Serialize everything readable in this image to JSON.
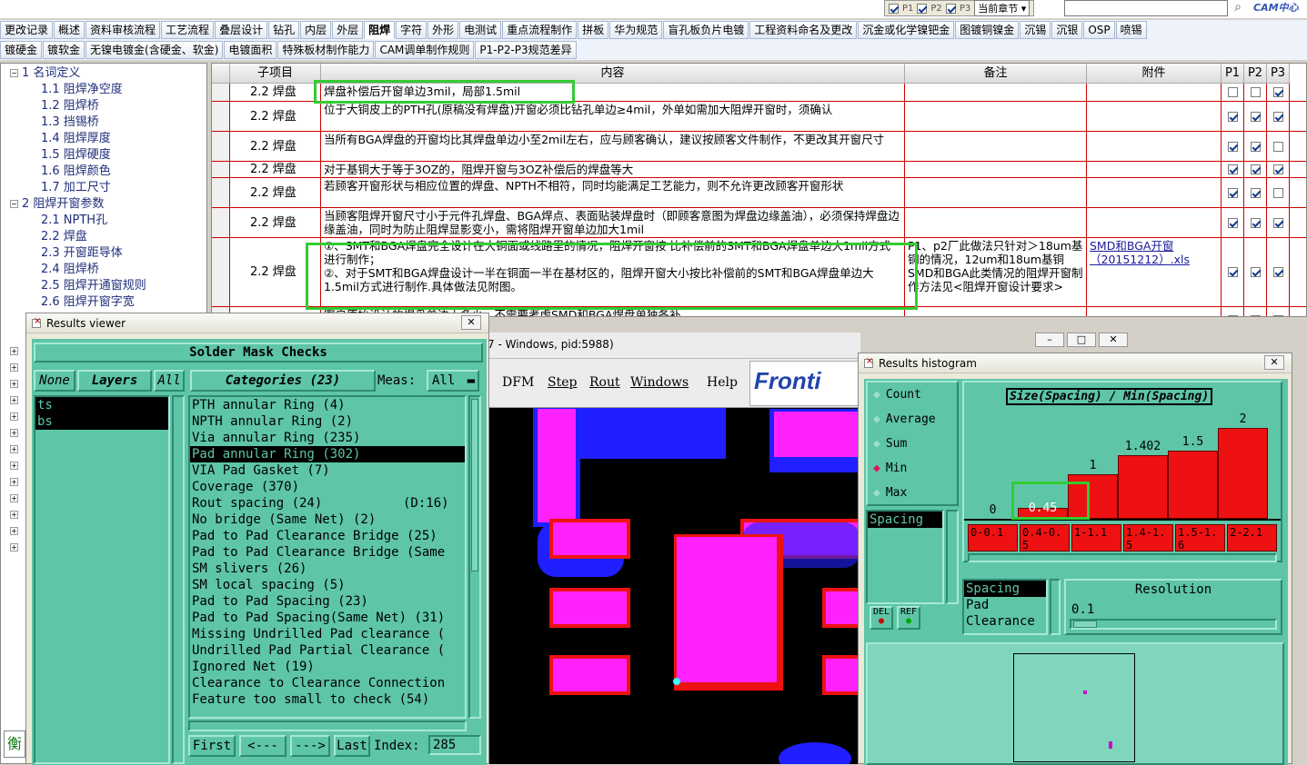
{
  "top_controls": {
    "p1": "P1",
    "p2": "P2",
    "p3": "P3",
    "chapter_select": "当前章节 ▾",
    "logo": "CAM中心"
  },
  "tabs_row1": [
    "更改记录",
    "概述",
    "资料审核流程",
    "工艺流程",
    "叠层设计",
    "钻孔",
    "内层",
    "外层",
    "阻焊",
    "字符",
    "外形",
    "电测试",
    "重点流程制作",
    "拼板",
    "华为规范",
    "盲孔板负片电镀",
    "工程资料命名及更改",
    "沉金或化学镍钯金",
    "图镀铜镍金",
    "沉锡",
    "沉银",
    "OSP",
    "喷锡"
  ],
  "tabs_row2": [
    "镀硬金",
    "镀软金",
    "无镍电镀金(含硬金、软金)",
    "电镀面积",
    "特殊板材制作能力",
    "CAM调单制作规则",
    "P1-P2-P3规范差异"
  ],
  "active_tab": "阻焊",
  "tree": {
    "sec1": "1 名词定义",
    "sec1_items": [
      "1.1 阻焊净空度",
      "1.2 阻焊桥",
      "1.3 挡锡桥",
      "1.4 阻焊厚度",
      "1.5 阻焊硬度",
      "1.6 阻焊颜色",
      "1.7 加工尺寸"
    ],
    "sec2": "2 阻焊开窗参数",
    "sec2_items": [
      "2.1 NPTH孔",
      "2.2 焊盘",
      "2.3 开窗距导体",
      "2.4 阻焊桥",
      "2.5 阻焊开通窗规则",
      "2.6 阻焊开窗字宽"
    ]
  },
  "table": {
    "headers": [
      "子项目",
      "内容",
      "备注",
      "附件",
      "P1",
      "P2",
      "P3"
    ],
    "rows": [
      {
        "cat": "2.2 焊盘",
        "content": "焊盘补偿后开窗单边3mil，局部1.5mil",
        "note": "",
        "attach": "",
        "p": [
          false,
          false,
          true
        ]
      },
      {
        "cat": "2.2 焊盘",
        "content": "位于大铜皮上的PTH孔(原稿没有焊盘)开窗必须比钻孔单边≥4mil，外单如需加大阻焊开窗时，须确认",
        "note": "",
        "attach": "",
        "p": [
          true,
          true,
          true
        ]
      },
      {
        "cat": "2.2 焊盘",
        "content": "当所有BGA焊盘的开窗均比其焊盘单边小至2mil左右，应与顾客确认，建议按顾客文件制作，不更改其开窗尺寸",
        "note": "",
        "attach": "",
        "p": [
          true,
          true,
          false
        ]
      },
      {
        "cat": "2.2 焊盘",
        "content": "对于基铜大于等于3OZ的，阻焊开窗与3OZ补偿后的焊盘等大",
        "note": "",
        "attach": "",
        "p": [
          true,
          true,
          true
        ]
      },
      {
        "cat": "2.2 焊盘",
        "content": "若顾客开窗形状与相应位置的焊盘、NPTH不相符，同时均能满足工艺能力，则不允许更改顾客开窗形状",
        "note": "",
        "attach": "",
        "p": [
          true,
          true,
          false
        ]
      },
      {
        "cat": "2.2 焊盘",
        "content": "当顾客阻焊开窗尺寸小于元件孔焊盘、BGA焊点、表面贴装焊盘时（即顾客意图为焊盘边缘盖油），必须保持焊盘边缘盖油，同时为防止阻焊显影变小，需将阻焊开窗单边加大1mil",
        "note": "",
        "attach": "",
        "p": [
          true,
          true,
          true
        ]
      },
      {
        "cat": "2.2 焊盘",
        "content": "①、SMT和BGA焊盘完全设计在大铜面或线路里的情况，阻焊开窗按 比补偿前的SMT和BGA焊盘单边大1mil方式进行制作；\n②、对于SMT和BGA焊盘设计一半在铜面一半在基材区的，阻焊开窗大小按比补偿前的SMT和BGA焊盘单边大1.5mil方式进行制作.具体做法见附图。",
        "note": "P1、p2厂此做法只针对＞18um基铜的情况，12um和18um基铜SMD和BGA此类情况的阻焊开窗制作方法见<阻焊开窗设计要求>",
        "attach": "SMD和BGA开窗（20151212）.xls",
        "p": [
          true,
          true,
          true
        ]
      },
      {
        "cat": "",
        "content": "客户原始设计的焊盘单边大多少，不需要考虑SMD和BGA焊盘单独各补",
        "note": "",
        "attach": "",
        "p": [
          true,
          true,
          true
        ]
      }
    ]
  },
  "results_viewer": {
    "title": "Results viewer",
    "header": "Solder Mask Checks",
    "btn_none": "None",
    "btn_layers": "Layers",
    "btn_all": "All",
    "categories_btn": "Categories (23)",
    "meas_label": "Meas:",
    "meas_value": "All",
    "layers": [
      "ts",
      "bs"
    ],
    "categories": [
      "PTH annular Ring (4)",
      "NPTH annular Ring (2)",
      "Via annular Ring (235)",
      "Pad annular Ring (302)",
      "VIA Pad Gasket (7)",
      "Coverage (370)",
      "Rout spacing (24)",
      "No bridge (Same Net) (2)",
      "Pad to Pad Clearance Bridge (25)",
      "Pad to Pad Clearance Bridge (Same",
      "SM slivers (26)",
      "SM local spacing (5)",
      "Pad to Pad Spacing (23)",
      "Pad to Pad Spacing(Same Net) (31)",
      "Missing Undrilled Pad clearance (",
      "Undrilled Pad Partial Clearance (",
      "Ignored Net (19)",
      "Clearance to Clearance Connection",
      "Feature too small to check (54)"
    ],
    "selected_category": "Pad annular Ring (302)",
    "rout_suffix": "(D:16)",
    "nav_first": "First",
    "nav_prev": "<---",
    "nav_next": "--->",
    "nav_last": "Last",
    "index_label": "Index:",
    "index_value": "285"
  },
  "cam_window": {
    "title_partial": "7 - Windows, pid:5988)",
    "menus": [
      "DFM",
      "Step",
      "Rout",
      "Windows",
      "Help"
    ],
    "logo": "Fronti"
  },
  "histogram": {
    "title": "Results histogram",
    "modes": [
      "Count",
      "Average",
      "Sum",
      "Min",
      "Max"
    ],
    "selected_mode": "Min",
    "chart_title": "Size(Spacing) / Min(Spacing)",
    "bar_values": [
      "0",
      "0.45",
      "1",
      "1.402",
      "1.5",
      "2"
    ],
    "bar_heights": [
      0,
      0.08,
      0.33,
      0.47,
      0.5,
      0.67
    ],
    "bins": [
      "0-0.1",
      "0.4-0.5",
      "1-1.1",
      "1.4-1.5",
      "1.5-1.6",
      "2-2.1"
    ],
    "size_list": [
      "Spacing"
    ],
    "type_list": [
      "Spacing",
      "Pad",
      "Clearance"
    ],
    "resolution_label": "Resolution",
    "resolution_value": "0.1",
    "del_label": "DEL",
    "ref_label": "REF"
  },
  "colors": {
    "highlight": "#33cc33",
    "motif": "#5ec5a7",
    "magenta": "#ff22ff",
    "red": "#ee1111"
  }
}
